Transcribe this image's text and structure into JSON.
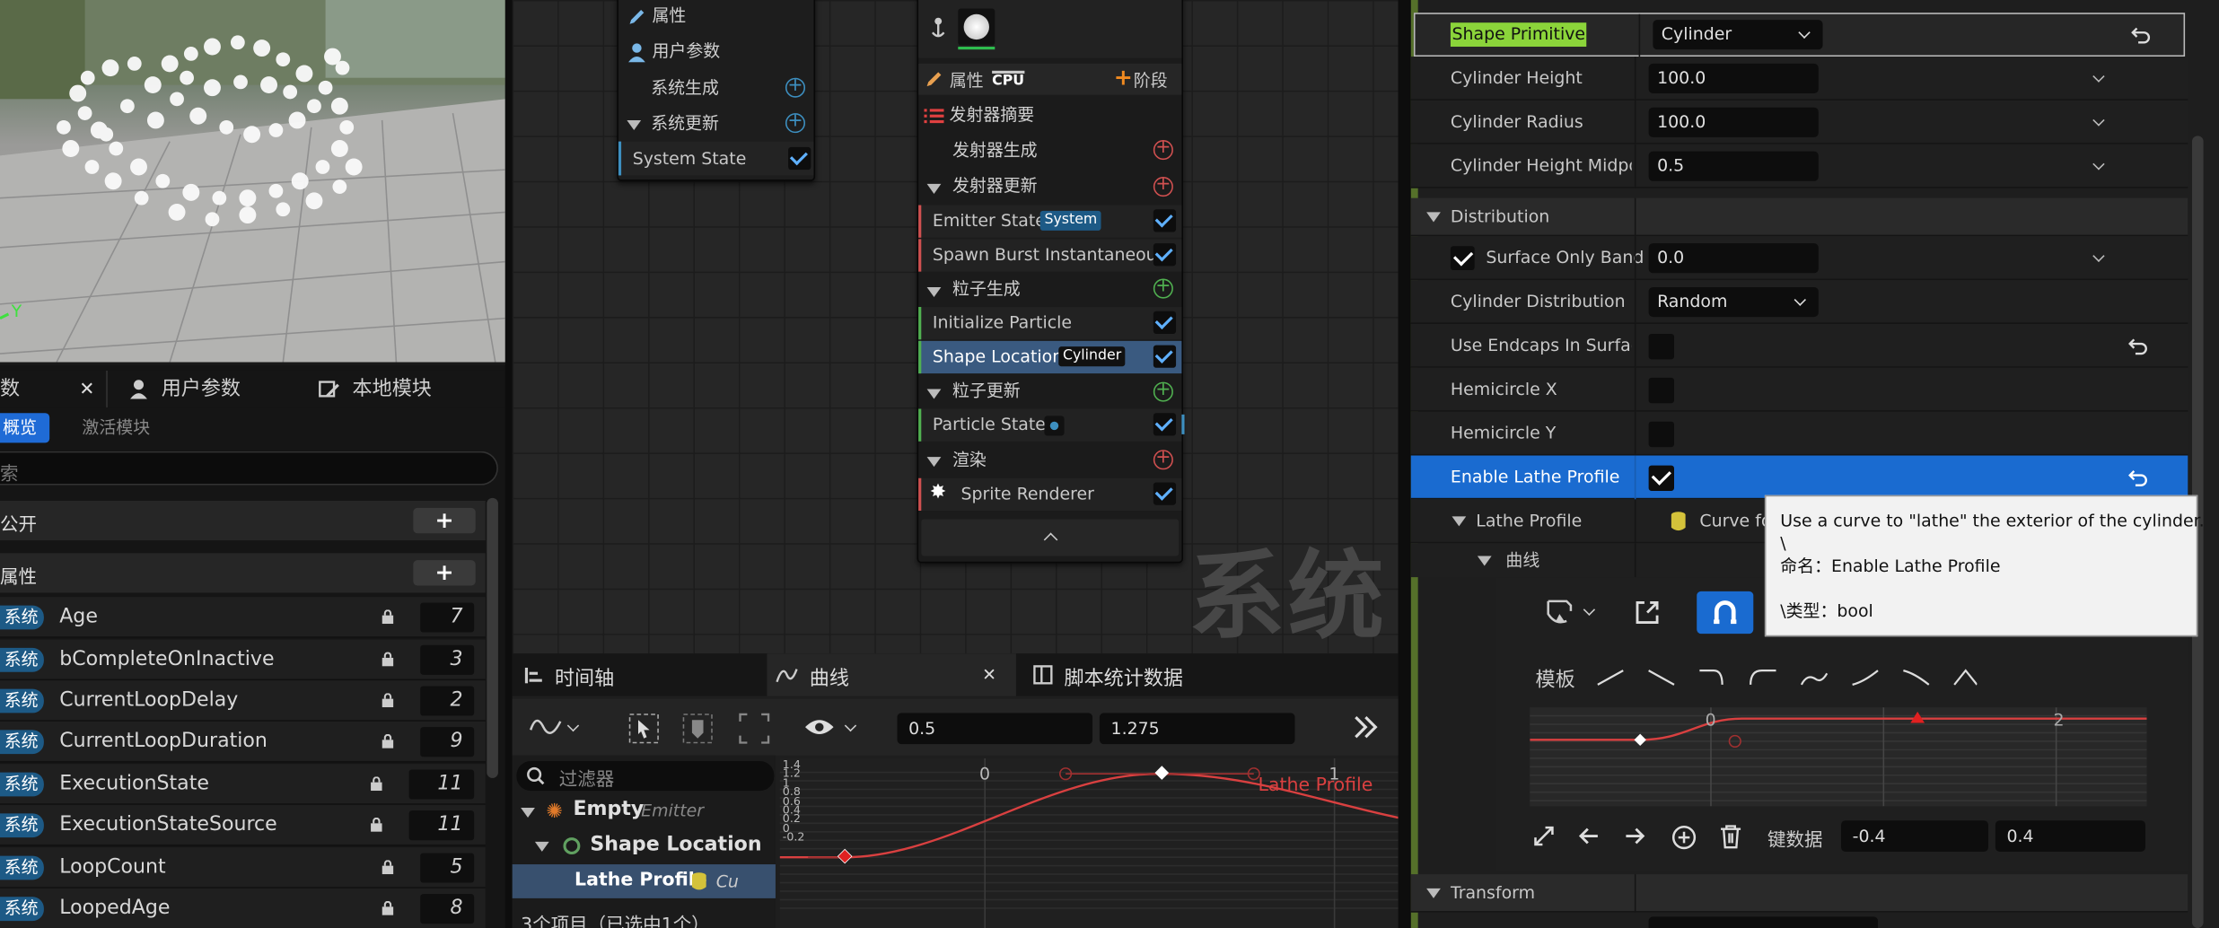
{
  "left_tabs": {
    "tab_partial": "数",
    "tab_user_params": "用户参数",
    "tab_local_modules": "本地模块"
  },
  "left_sub": {
    "overview": "概览",
    "active_modules": "激活模块"
  },
  "search_placeholder": "索",
  "sections": {
    "public": "公开",
    "attributes": "属性"
  },
  "tag_system": "系统",
  "attr_rows": [
    {
      "name": "Age",
      "value": "7"
    },
    {
      "name": "bCompleteOnInactive",
      "value": "3"
    },
    {
      "name": "CurrentLoopDelay",
      "value": "2"
    },
    {
      "name": "CurrentLoopDuration",
      "value": "9"
    },
    {
      "name": "ExecutionState",
      "value": "11"
    },
    {
      "name": "ExecutionStateSource",
      "value": "11"
    },
    {
      "name": "LoopCount",
      "value": "5"
    },
    {
      "name": "LoopedAge",
      "value": "8"
    }
  ],
  "viewport_axis": "Y",
  "system_node": {
    "attributes": "属性",
    "user_params": "用户参数",
    "system_spawn": "系统生成",
    "system_update": "系统更新",
    "system_state": "System State"
  },
  "emitter_node": {
    "attributes": "属性",
    "cpu": "CPU",
    "stage": "阶段",
    "summary": "发射器摘要",
    "emitter_spawn": "发射器生成",
    "emitter_update": "发射器更新",
    "emitter_state": "Emitter State",
    "system_pill": "System",
    "spawn_burst": "Spawn Burst Instantaneous",
    "particle_spawn": "粒子生成",
    "init_particle": "Initialize Particle",
    "shape_location": "Shape Location",
    "cylinder_pill": "Cylinder",
    "particle_update": "粒子更新",
    "particle_state": "Particle State",
    "render": "渲染",
    "sprite_renderer": "Sprite Renderer"
  },
  "watermark": "系统",
  "bottom_tabs": {
    "timeline": "时间轴",
    "curve": "曲线",
    "script_stats": "脚本统计数据"
  },
  "curve_toolbar": {
    "value_a": "0.5",
    "value_b": "1.275"
  },
  "curve_tree": {
    "filter_placeholder": "过滤器",
    "empty": "Empty",
    "emitter": "Emitter",
    "shape_location": "Shape Location",
    "lathe_profile": "Lathe Profile",
    "cu": "Cu",
    "footer": "3个项目（已选中1个）"
  },
  "curve_graph": {
    "label": "Lathe Profile",
    "x_ticks": [
      "0",
      "1"
    ],
    "y_ticks": [
      "1.4",
      "1.2",
      "1",
      "0.8",
      "0.6",
      "0.4",
      "0.2",
      "0",
      "-0.2"
    ]
  },
  "details": {
    "shape_primitive": "Shape Primitive",
    "shape_primitive_value": "Cylinder",
    "cylinder_height": "Cylinder Height",
    "cylinder_height_value": "100.0",
    "cylinder_radius": "Cylinder Radius",
    "cylinder_radius_value": "100.0",
    "cylinder_midpoint": "Cylinder Height Midpoi",
    "cylinder_midpoint_value": "0.5",
    "distribution": "Distribution",
    "surface_only_band": "Surface Only Band",
    "surface_only_band_value": "0.0",
    "cylinder_distribution": "Cylinder Distribution",
    "cylinder_distribution_value": "Random",
    "use_endcaps": "Use Endcaps In Surface",
    "hemicircle_x": "Hemicircle X",
    "hemicircle_y": "Hemicircle Y",
    "enable_lathe": "Enable Lathe Profile",
    "lathe_profile": "Lathe Profile",
    "curve_for": "Curve fo",
    "curve": "曲线",
    "template": "模板",
    "keydata": "键数据",
    "key_a": "-0.4",
    "key_b": "0.4",
    "mini_x_ticks": [
      "0",
      "2"
    ],
    "transform": "Transform"
  },
  "tooltip": {
    "line1": "Use a curve to \"lathe\" the exterior of the cylinder.",
    "line2": "\\",
    "line3": "命名：Enable Lathe Profile",
    "line4": "\\类型：bool"
  }
}
